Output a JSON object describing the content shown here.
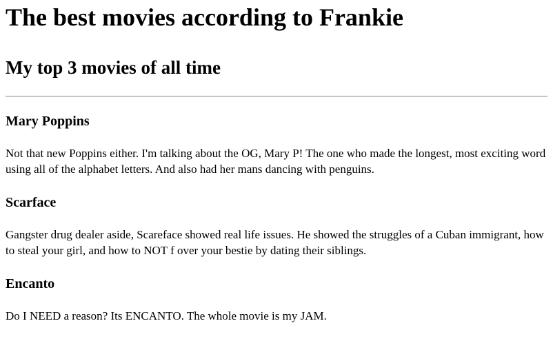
{
  "page": {
    "title": "The best movies according to Frankie",
    "subtitle": "My top 3 movies of all time"
  },
  "movies": [
    {
      "title": "Mary Poppins",
      "description": "Not that new Poppins either. I'm talking about the OG, Mary P! The one who made the longest, most exciting word using all of the alphabet letters. And also had her mans dancing with penguins."
    },
    {
      "title": "Scarface",
      "description": "Gangster drug dealer aside, Scareface showed real life issues. He showed the struggles of a Cuban immigrant, how to steal your girl, and how to NOT f over your bestie by dating their siblings."
    },
    {
      "title": "Encanto",
      "description": "Do I NEED a reason? Its ENCANTO. The whole movie is my JAM."
    }
  ]
}
